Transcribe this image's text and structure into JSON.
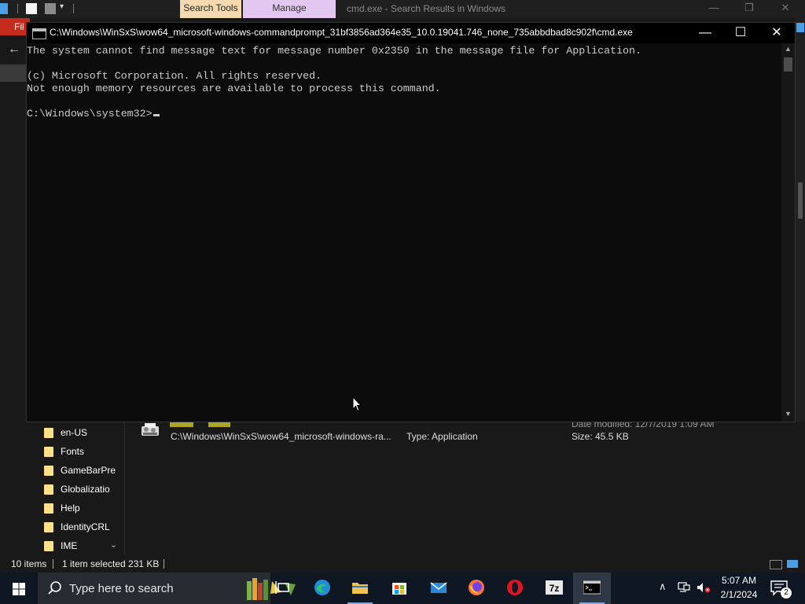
{
  "explorer": {
    "ribbon_tabs": {
      "search_tools": "Search Tools",
      "manage": "Manage"
    },
    "window_title": "cmd.exe - Search Results in Windows",
    "controls": {
      "minimize": "—",
      "maximize": "❐",
      "close": "✕"
    },
    "ribbon_file": "Fil",
    "nav_items": [
      {
        "label": "en-US"
      },
      {
        "label": "Fonts"
      },
      {
        "label": "GameBarPre"
      },
      {
        "label": "Globalizatio"
      },
      {
        "label": "Help"
      },
      {
        "label": "IdentityCRL"
      },
      {
        "label": "IME"
      }
    ],
    "result": {
      "path": "C:\\Windows\\WinSxS\\wow64_microsoft-windows-ra...",
      "type": "Type: Application",
      "date": "Date modified: 12/7/2019 1:09 AM",
      "size": "Size: 45.5 KB"
    },
    "status": {
      "items": "10 items",
      "selected": "1 item selected  231 KB"
    }
  },
  "cmd": {
    "title": "C:\\Windows\\WinSxS\\wow64_microsoft-windows-commandprompt_31bf3856ad364e35_10.0.19041.746_none_735abbdbad8c902f\\cmd.exe",
    "controls": {
      "minimize": "—",
      "maximize": "☐",
      "close": "✕"
    },
    "lines": [
      "The system cannot find message text for message number 0x2350 in the message file for Application.",
      "",
      "(c) Microsoft Corporation. All rights reserved.",
      "Not enough memory resources are available to process this command.",
      "",
      "C:\\Windows\\system32>"
    ],
    "colors": {
      "background": "#0c0c0c",
      "text": "#cccccc"
    }
  },
  "taskbar": {
    "search_placeholder": "Type here to search",
    "apps": [
      "task-view",
      "edge",
      "file-explorer",
      "microsoft-store",
      "mail",
      "firefox",
      "opera",
      "7-zip",
      "command-prompt"
    ],
    "clock": {
      "time": "5:07 AM",
      "date": "2/1/2024"
    },
    "notification_count": "2",
    "seven_zip_label": "7z"
  }
}
